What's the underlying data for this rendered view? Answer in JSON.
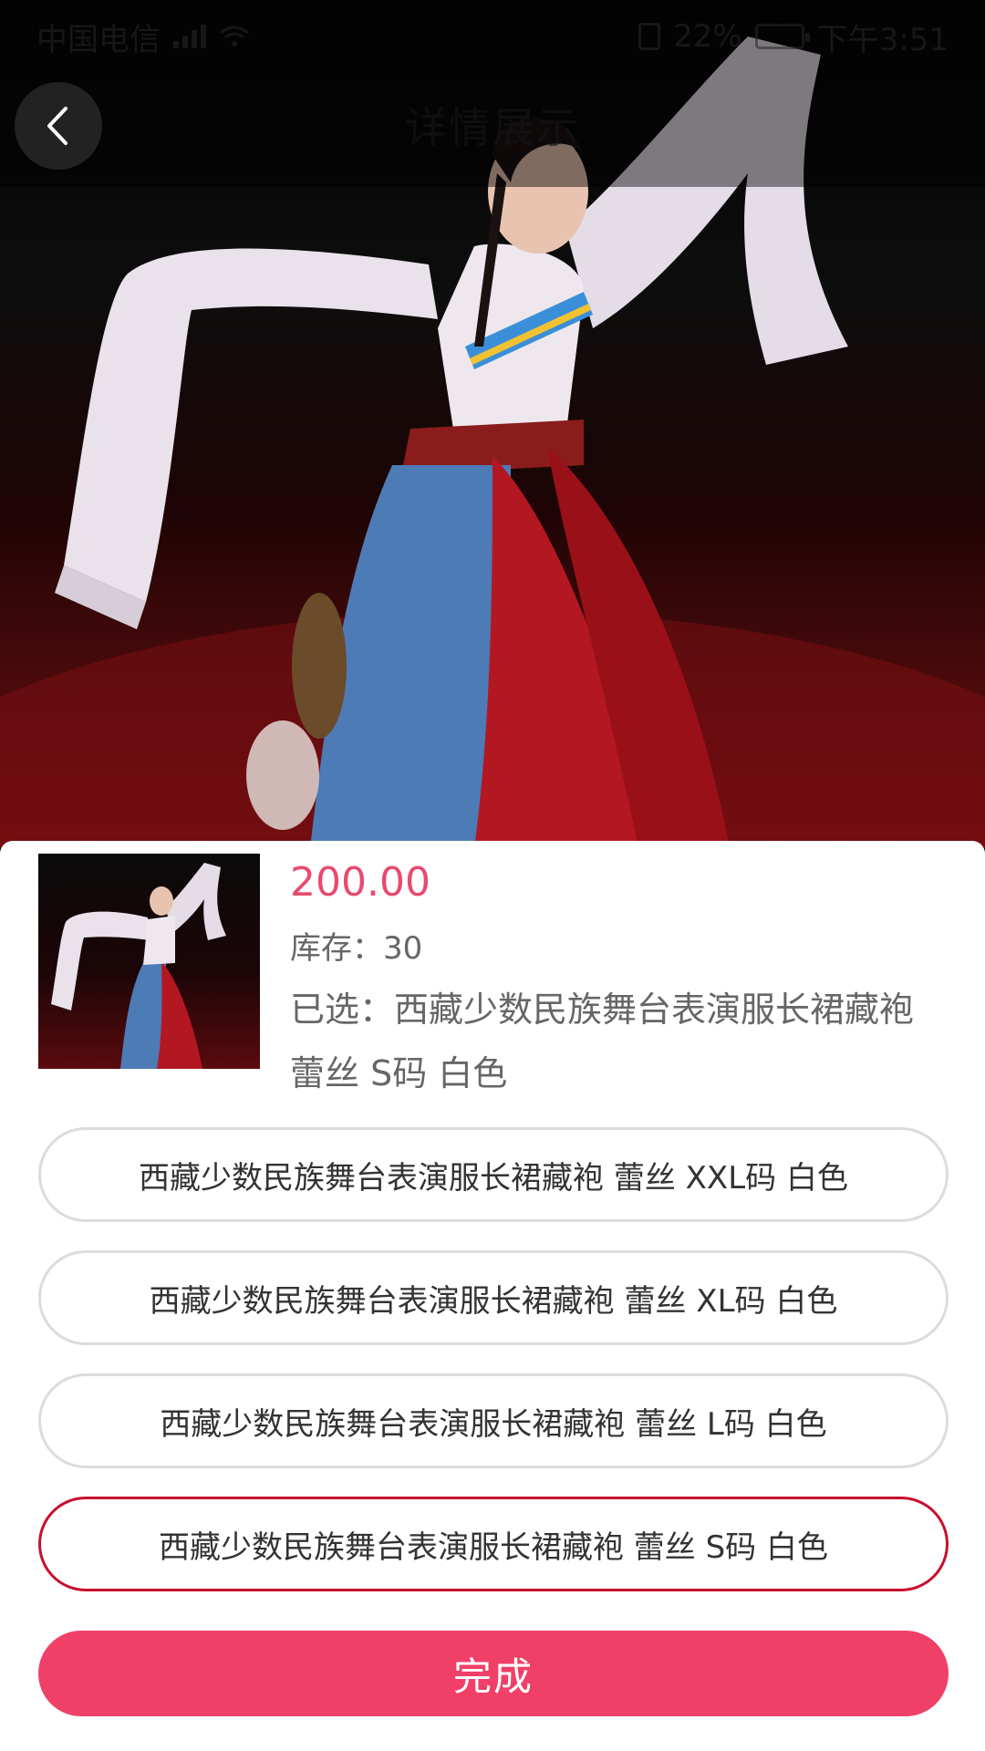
{
  "status_bar": {
    "carrier": "中国电信",
    "battery": "22%",
    "time": "下午3:51"
  },
  "header": {
    "title": "详情展示"
  },
  "product": {
    "price": "200.00",
    "stock": "库存：30",
    "selected": "已选：西藏少数民族舞台表演服长裙藏袍 蕾丝 S码 白色"
  },
  "options": [
    {
      "label": "西藏少数民族舞台表演服长裙藏袍 蕾丝 XXL码 白色",
      "selected": false
    },
    {
      "label": "西藏少数民族舞台表演服长裙藏袍 蕾丝 XL码 白色",
      "selected": false
    },
    {
      "label": "西藏少数民族舞台表演服长裙藏袍 蕾丝 L码 白色",
      "selected": false
    },
    {
      "label": "西藏少数民族舞台表演服长裙藏袍 蕾丝 S码 白色",
      "selected": true
    }
  ],
  "actions": {
    "done_label": "完成"
  },
  "colors": {
    "accent": "#f04068",
    "price": "#e84a6f",
    "selected_border": "#c8102e"
  },
  "icons": {
    "back": "chevron-left-icon",
    "signal": "signal-icon",
    "wifi": "wifi-icon",
    "battery": "battery-icon"
  }
}
